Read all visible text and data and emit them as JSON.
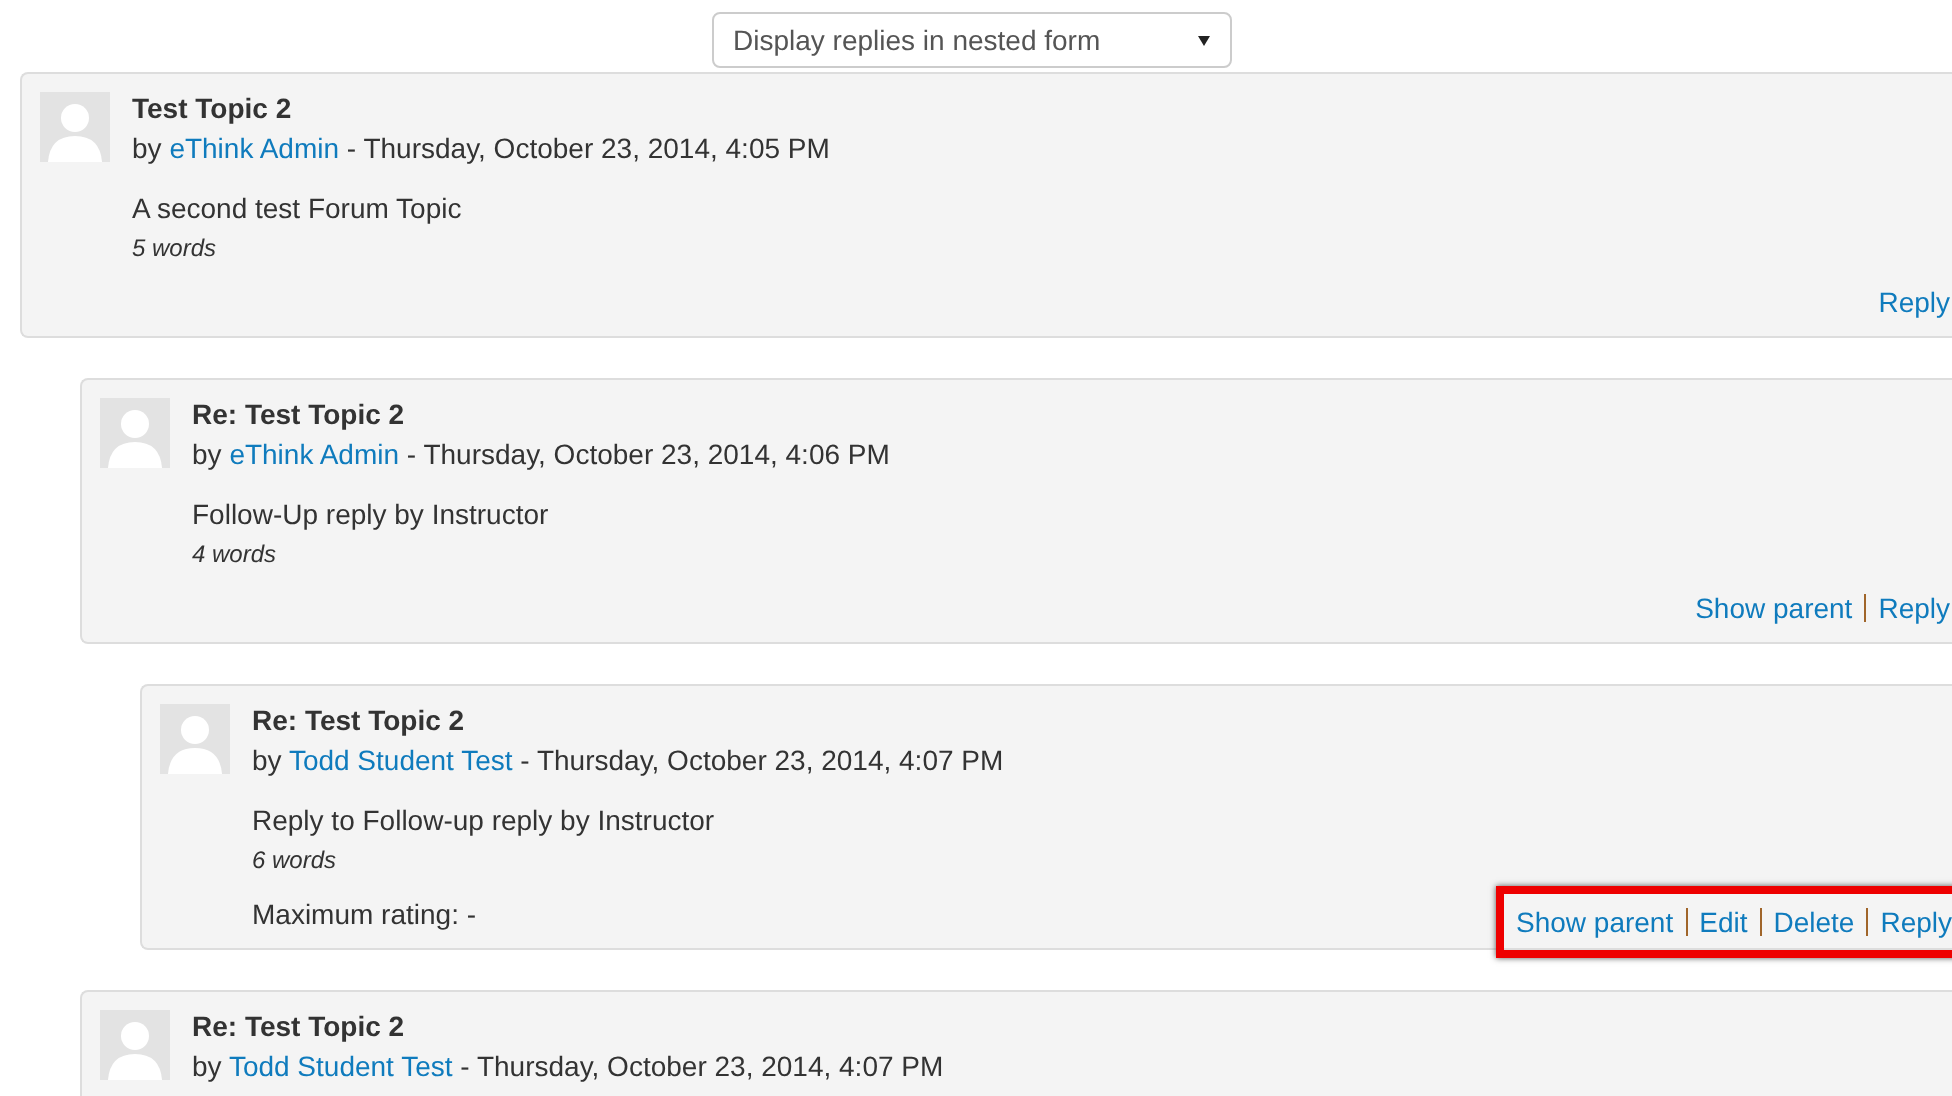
{
  "display_mode": {
    "value": "Display replies in nested form"
  },
  "posts": [
    {
      "subject": "Test Topic 2",
      "byline_prefix": "by",
      "author": "eThink Admin",
      "date": "- Thursday, October 23, 2014, 4:05 PM",
      "message": "A second test Forum Topic",
      "word_count": "5 words",
      "highlighted": false,
      "actions": [
        {
          "label": "Reply"
        }
      ],
      "children": [
        {
          "subject": "Re: Test Topic 2",
          "byline_prefix": "by",
          "author": "eThink Admin",
          "date": "- Thursday, October 23, 2014, 4:06 PM",
          "message": "Follow-Up reply by Instructor",
          "word_count": "4 words",
          "highlighted": false,
          "actions": [
            {
              "label": "Show parent"
            },
            {
              "label": "Reply"
            }
          ],
          "children": [
            {
              "subject": "Re: Test Topic 2",
              "byline_prefix": "by",
              "author": "Todd Student Test",
              "date": "- Thursday, October 23, 2014, 4:07 PM",
              "message": "Reply to Follow-up reply by Instructor",
              "word_count": "6 words",
              "rating": "Maximum rating: -",
              "highlighted": true,
              "actions": [
                {
                  "label": "Show parent"
                },
                {
                  "label": "Edit"
                },
                {
                  "label": "Delete"
                },
                {
                  "label": "Reply"
                }
              ]
            }
          ]
        },
        {
          "subject": "Re: Test Topic 2",
          "byline_prefix": "by",
          "author": "Todd Student Test",
          "date": "- Thursday, October 23, 2014, 4:07 PM"
        }
      ]
    }
  ]
}
